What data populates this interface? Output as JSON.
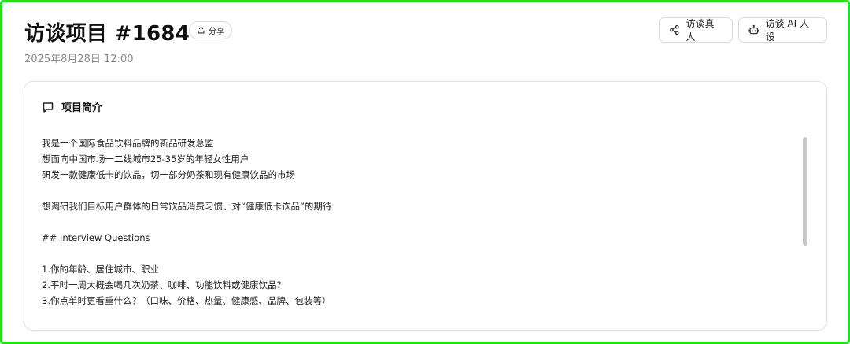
{
  "header": {
    "title": "访谈项目 #1684",
    "share_label": "分享",
    "date": "2025年8月28日 12:00"
  },
  "actions": {
    "interview_human_label": "访谈真人",
    "interview_ai_label": "访谈 AI 人设"
  },
  "card": {
    "heading": "项目简介",
    "lines": [
      "我是一个国际食品饮料品牌的新品研发总监",
      "想面向中国市场一二线城市25-35岁的年轻女性用户",
      "研发一款健康低卡的饮品，切一部分奶茶和现有健康饮品的市场",
      "",
      "想调研我们目标用户群体的日常饮品消费习惯、对“健康低卡饮品”的期待",
      "",
      "## Interview Questions",
      "",
      "1.你的年龄、居住城市、职业",
      "2.平时一周大概会喝几次奶茶、咖啡、功能饮料或健康饮品?",
      "3.你点单时更看重什么？（口味、价格、热量、健康感、品牌、包装等）"
    ]
  },
  "icons": {
    "share": "share-upload-icon",
    "human": "share-nodes-icon",
    "ai": "robot-icon",
    "heading": "message-square-icon"
  },
  "colors": {
    "frame": "#22e01f",
    "scrollbar": "#c9c9c9",
    "muted_text": "#8a8a8a"
  }
}
